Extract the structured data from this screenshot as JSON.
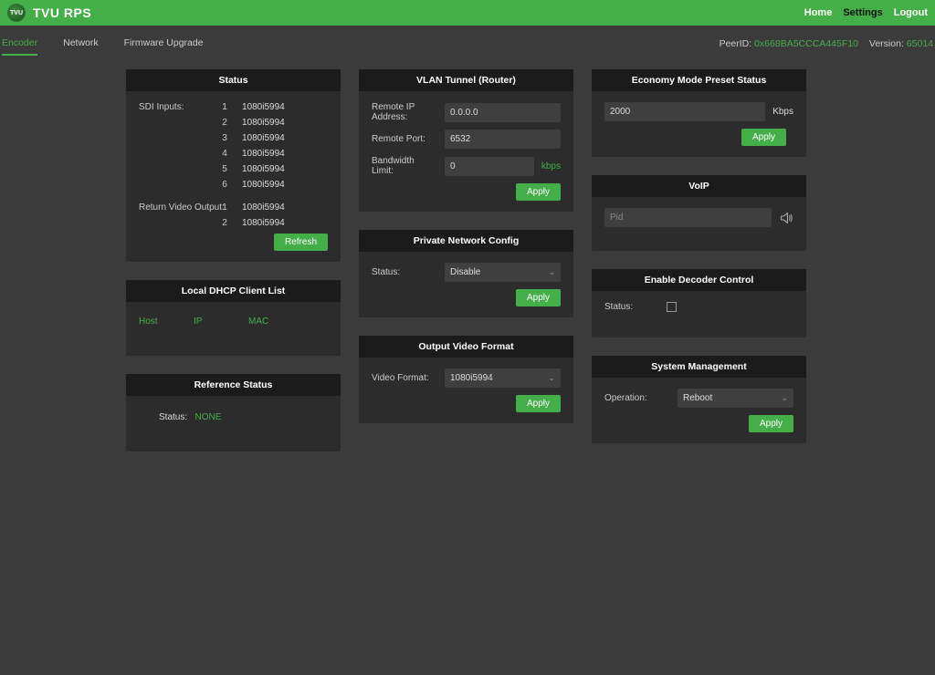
{
  "app": {
    "logoText": "TVU",
    "title": "TVU RPS"
  },
  "topnav": {
    "home": "Home",
    "settings": "Settings",
    "logout": "Logout"
  },
  "subtabs": {
    "encoder": "Encoder",
    "network": "Network",
    "firmware": "Firmware Upgrade"
  },
  "peer": {
    "label": "PeerID:",
    "value": "0x668BA5CCCA445F10"
  },
  "version": {
    "label": "Version:",
    "value": "65014"
  },
  "status": {
    "header": "Status",
    "sdiLabel": "SDI Inputs:",
    "sdi": [
      {
        "n": "1",
        "v": "1080i5994"
      },
      {
        "n": "2",
        "v": "1080i5994"
      },
      {
        "n": "3",
        "v": "1080i5994"
      },
      {
        "n": "4",
        "v": "1080i5994"
      },
      {
        "n": "5",
        "v": "1080i5994"
      },
      {
        "n": "6",
        "v": "1080i5994"
      }
    ],
    "returnLabel": "Return Video Output:",
    "ret": [
      {
        "n": "1",
        "v": "1080i5994"
      },
      {
        "n": "2",
        "v": "1080i5994"
      }
    ],
    "refresh": "Refresh"
  },
  "dhcp": {
    "header": "Local DHCP Client List",
    "cols": {
      "host": "Host",
      "ip": "IP",
      "mac": "MAC"
    }
  },
  "reference": {
    "header": "Reference Status",
    "label": "Status:",
    "value": "NONE"
  },
  "vlan": {
    "header": "VLAN Tunnel (Router)",
    "ipLabel": "Remote IP Address:",
    "ipVal": "0.0.0.0",
    "portLabel": "Remote Port:",
    "portVal": "6532",
    "bwLabel": "Bandwidth Limit:",
    "bwVal": "0",
    "bwUnit": "kbps",
    "apply": "Apply"
  },
  "pnet": {
    "header": "Private Network Config",
    "statusLabel": "Status:",
    "statusVal": "Disable",
    "apply": "Apply"
  },
  "ovf": {
    "header": "Output Video Format",
    "label": "Video Format:",
    "value": "1080i5994",
    "apply": "Apply"
  },
  "econ": {
    "header": "Economy Mode Preset Status",
    "value": "2000",
    "unit": "Kbps",
    "apply": "Apply"
  },
  "voip": {
    "header": "VoIP",
    "placeholder": "Pid"
  },
  "decoder": {
    "header": "Enable Decoder Control",
    "label": "Status:"
  },
  "sysman": {
    "header": "System Management",
    "opLabel": "Operation:",
    "opVal": "Reboot",
    "apply": "Apply"
  }
}
